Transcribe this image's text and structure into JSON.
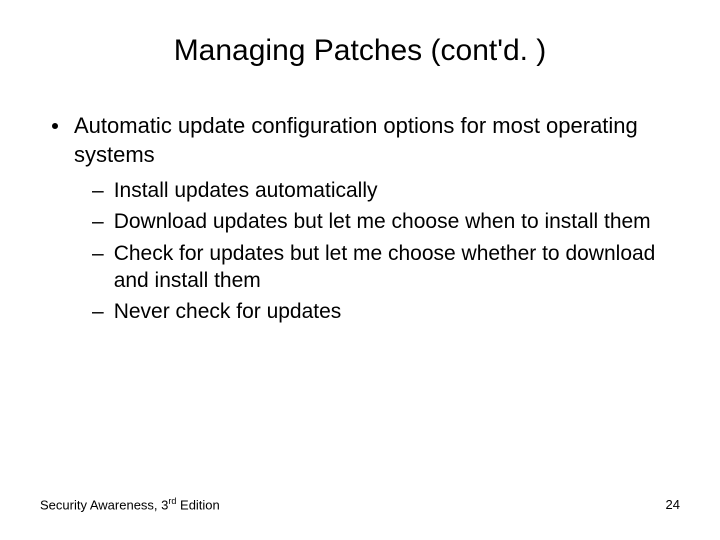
{
  "title": "Managing Patches (cont'd. )",
  "bullet": "Automatic update configuration options for most operating systems",
  "subs": [
    "Install updates automatically",
    "Download updates but let me choose when to install them",
    "Check for updates but let me choose whether to download and install them",
    "Never check for updates"
  ],
  "footer_book_prefix": "Security Awareness, 3",
  "footer_book_sup": "rd",
  "footer_book_suffix": " Edition",
  "page_number": "24"
}
